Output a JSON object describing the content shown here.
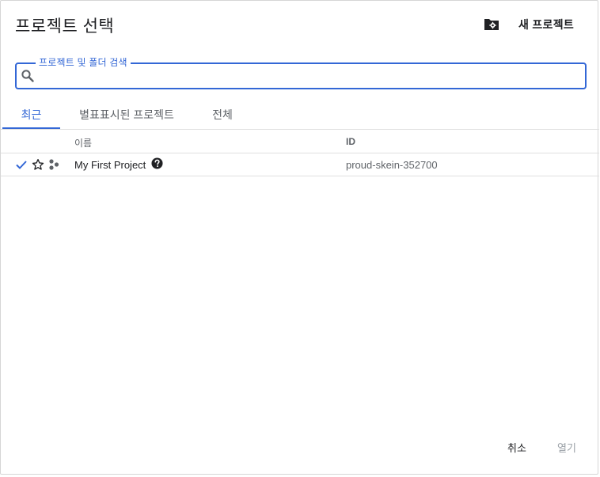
{
  "dialog": {
    "title": "프로젝트 선택",
    "new_project_label": "새 프로젝트"
  },
  "search": {
    "label": "프로젝트 및 폴더 검색",
    "value": ""
  },
  "tabs": [
    {
      "label": "최근",
      "active": true
    },
    {
      "label": "별표표시된 프로젝트",
      "active": false
    },
    {
      "label": "전체",
      "active": false
    }
  ],
  "table": {
    "columns": {
      "name": "이름",
      "id": "ID"
    },
    "rows": [
      {
        "selected": true,
        "starred": false,
        "name": "My First Project",
        "id": "proud-skein-352700"
      }
    ]
  },
  "footer": {
    "cancel_label": "취소",
    "open_label": "열기"
  },
  "colors": {
    "accent": "#3367d6",
    "text": "#202124",
    "secondary_text": "#5f6368",
    "disabled_text": "#9aa0a6"
  },
  "icons": {
    "new_project": "folder-gear-icon",
    "search": "search-icon",
    "selected": "check-icon",
    "star": "star-outline-icon",
    "org": "organization-icon",
    "help": "help-circle-icon"
  }
}
